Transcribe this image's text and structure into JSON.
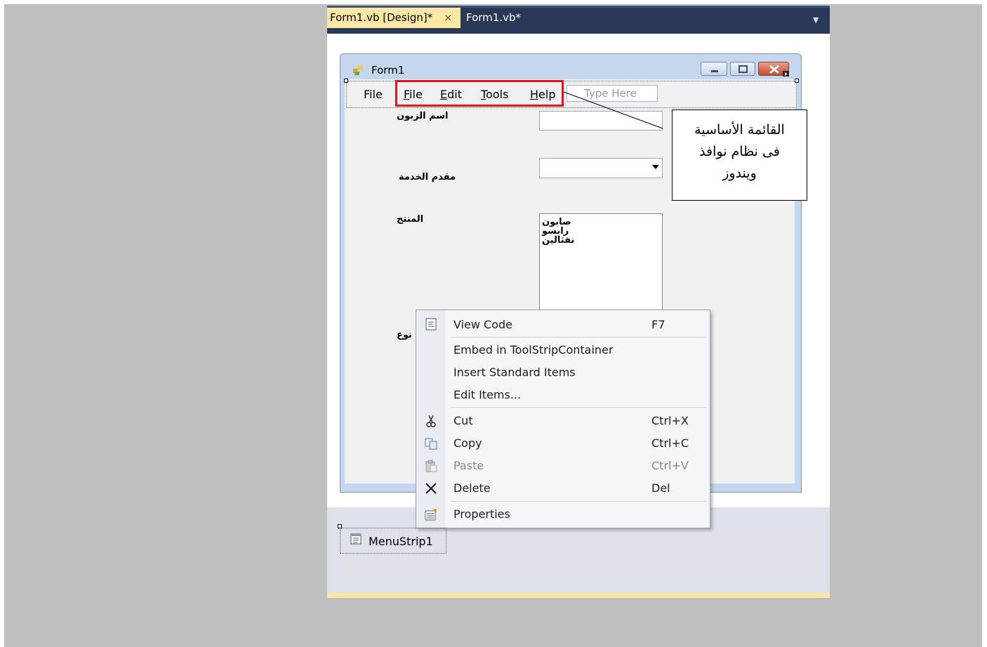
{
  "tabs": {
    "design": "Form1.vb [Design]*",
    "design_close": "×",
    "code": "Form1.vb*"
  },
  "form": {
    "title": "Form1",
    "menu": {
      "file_plain": "File",
      "items": [
        {
          "u": "F",
          "rest": "ile"
        },
        {
          "u": "E",
          "rest": "dit"
        },
        {
          "u": "T",
          "rest": "ools"
        },
        {
          "u": "H",
          "rest": "elp"
        }
      ],
      "type_here": "Type Here"
    },
    "labels": {
      "customer": "اسم الزبون",
      "provider": "مقدم الخدمة",
      "product": "المنتج",
      "type": "نوع"
    },
    "product_list": [
      "صابون",
      "رابسو",
      "نفثالين"
    ]
  },
  "callout": {
    "line1": "القائمة الأساسية",
    "line2": "فى نظام نوافذ",
    "line3": "ويندوز"
  },
  "context_menu": {
    "view_code": "View Code",
    "view_code_sc": "F7",
    "embed": "Embed in ToolStripContainer",
    "insert_std": "Insert Standard Items",
    "edit_items": "Edit Items...",
    "cut": "Cut",
    "cut_sc": "Ctrl+X",
    "copy": "Copy",
    "copy_sc": "Ctrl+C",
    "paste": "Paste",
    "paste_sc": "Ctrl+V",
    "delete": "Delete",
    "delete_sc": "Del",
    "properties": "Properties"
  },
  "tray": {
    "component": "MenuStrip1"
  },
  "colors": {
    "highlight_box": "#e8141c",
    "tab_active": "#ffe8a6",
    "tab_bar": "#293955"
  }
}
